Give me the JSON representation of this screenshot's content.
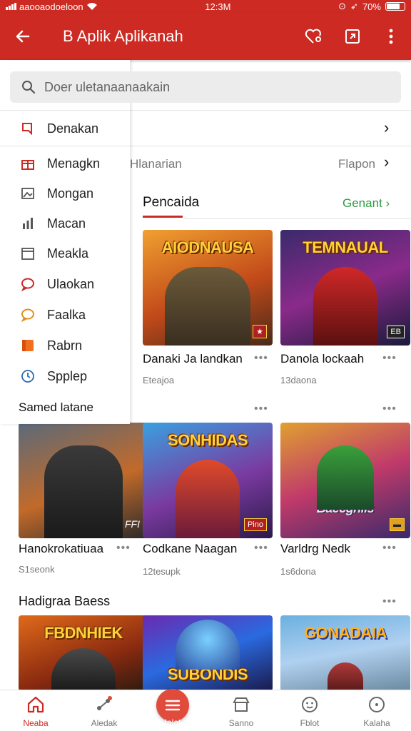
{
  "status_bar": {
    "carrier": "aaooaodoeloon",
    "time": "12:3M",
    "battery": "70%"
  },
  "app_bar": {
    "title": "B Aplik Aplikanah"
  },
  "search": {
    "placeholder": "Doer uletanaanaakain"
  },
  "drawer": {
    "items": [
      {
        "label": "Denakan",
        "icon": "bookmark-icon"
      },
      {
        "label": "Menagkn",
        "icon": "gift-icon"
      },
      {
        "label": "Mongan",
        "icon": "image-icon"
      },
      {
        "label": "Macan",
        "icon": "bar-chart-icon"
      },
      {
        "label": "Meakla",
        "icon": "calendar-icon"
      },
      {
        "label": "Ulaokan",
        "icon": "chat-icon"
      },
      {
        "label": "Faalka",
        "icon": "speech-bubble-icon"
      },
      {
        "label": "Rabrn",
        "icon": "square-icon"
      },
      {
        "label": "Spplep",
        "icon": "clock-icon"
      }
    ],
    "section_label": "Samed latane"
  },
  "menu_rows": {
    "row2_left": "Hlanarian",
    "row2_right": "Flapon"
  },
  "section1": {
    "title": "Pencaida",
    "more": "Genant"
  },
  "section3": {
    "title": "Hadigraa Baess"
  },
  "colors": {
    "brand_red": "#cc2a22",
    "link_green": "#2e9b3e"
  },
  "cards_row1": [
    {
      "name": "Danaki Ja landkan",
      "sub": "Eteajoa",
      "caption": "AIODNAUSA",
      "badge": ""
    },
    {
      "name": "Danola lockaah",
      "sub": "13daona",
      "caption": "TEMNAUAL",
      "badge": "EB"
    }
  ],
  "cards_row2": [
    {
      "name": "Hanokrokatiuaa",
      "sub": "S1seonk",
      "caption": "",
      "badge": "FFI"
    },
    {
      "name": "Codkane Naagan",
      "sub": "12tesupk",
      "caption": "SONHIDAS",
      "badge": "Pino"
    },
    {
      "name": "Varldrg Nedk",
      "sub": "1s6dona",
      "caption": "Baecgnlis",
      "badge": ""
    }
  ],
  "cards_row3": [
    {
      "caption": "FBDNHIEK"
    },
    {
      "caption": "SUBONDIS"
    },
    {
      "caption": "GONADAIA"
    }
  ],
  "tabs": [
    {
      "label": "Neaba",
      "icon": "home-icon"
    },
    {
      "label": "Aledak",
      "icon": "share-icon"
    },
    {
      "label": "Ialat",
      "icon": "menu-icon"
    },
    {
      "label": "Sanno",
      "icon": "store-icon"
    },
    {
      "label": "Fblot",
      "icon": "face-icon"
    },
    {
      "label": "Kalaha",
      "icon": "compass-icon"
    }
  ]
}
